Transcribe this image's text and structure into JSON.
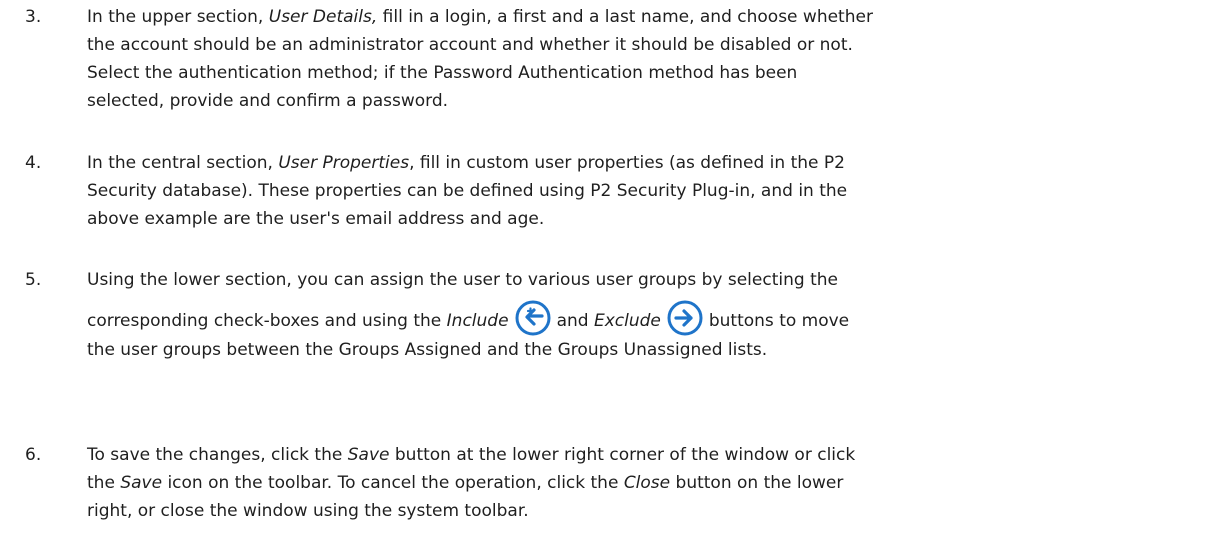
{
  "steps": [
    {
      "num": "3.",
      "lines": [
        [
          "In the upper section, ",
          "User Details,",
          " fill in a login, a first and a last name, and choose whether"
        ],
        "the account should be an administrator account and whether it should be disabled or not.",
        "Select the authentication method; if the Password Authentication method has been",
        "selected, provide and confirm a password."
      ]
    },
    {
      "num": "4.",
      "lines": [
        [
          "In the central section, ",
          "User Properties",
          ", fill in custom user properties (as defined in the P2"
        ],
        "Security database). These properties can be defined using P2 Security Plug-in, and in the",
        "above example are the user's email address and age."
      ]
    },
    {
      "num": "5.",
      "line1": "Using the lower section, you can assign the user to various user groups by selecting the",
      "line2_a": "corresponding check-boxes and using the ",
      "line2_include": "Include",
      "line2_and": "and ",
      "line2_exclude": "Exclude",
      "line2_b": "buttons to move",
      "line3": "the user groups between the Groups Assigned and the Groups Unassigned lists."
    },
    {
      "num": "6.",
      "line1_a": "To save the changes, click the ",
      "line1_save": "Save",
      "line1_b": " button at the lower right corner of the window or click",
      "line2_a": "the ",
      "line2_save": "Save",
      "line2_b": " icon on the toolbar. To cancel the operation, click the ",
      "line2_close": "Close",
      "line2_c": " button on the lower",
      "line3": "right, or close the window using the system toolbar."
    }
  ],
  "icons": {
    "include": "include-arrow-left-icon",
    "exclude": "exclude-arrow-right-icon",
    "color": "#1f74c9"
  }
}
